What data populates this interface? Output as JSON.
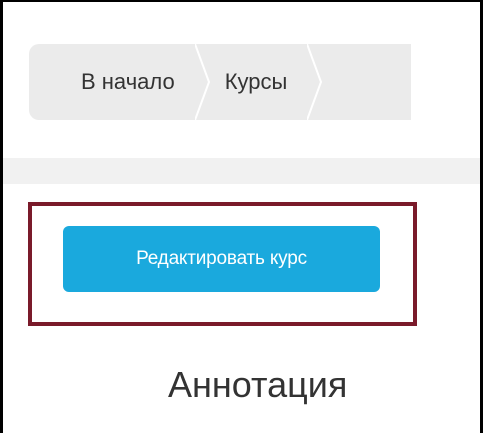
{
  "breadcrumb": {
    "items": [
      {
        "label": "В начало"
      },
      {
        "label": "Курсы"
      },
      {
        "label": ""
      }
    ]
  },
  "actions": {
    "edit_course_label": "Редактировать курс"
  },
  "section": {
    "title": "Аннотация"
  },
  "colors": {
    "button_bg": "#1aa9dd",
    "highlight_border": "#7a1a2a",
    "breadcrumb_bg": "#ebebeb"
  }
}
